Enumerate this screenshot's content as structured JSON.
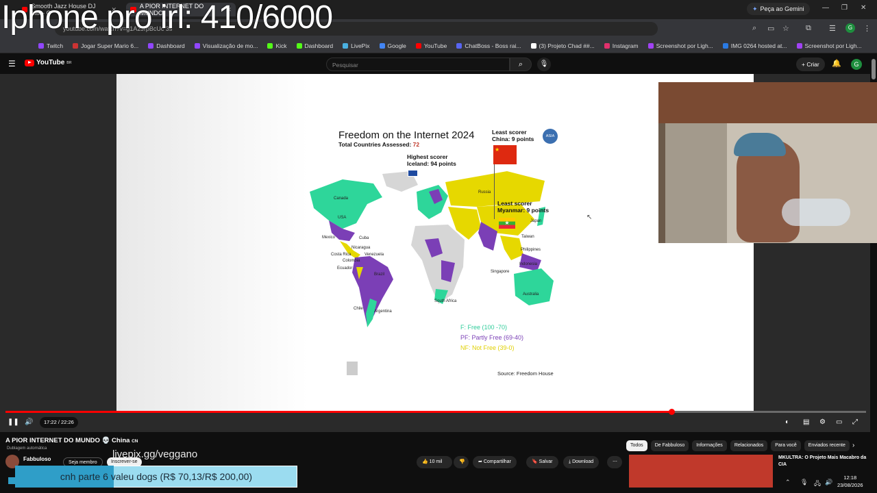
{
  "overlay": {
    "title": "Iphone pro irl: 410/6000"
  },
  "browser": {
    "tabs": [
      {
        "label": "Smooth Jazz House DJ Mix - C",
        "active": false
      },
      {
        "label": "A PIOR INTERNET DO MUNDO",
        "active": true
      }
    ],
    "gemini_label": "Peça ao Gemini",
    "url": "youtube.com/watch?v=g1A2JrpBcUc 3s",
    "bookmarks": [
      {
        "label": "Twitch",
        "color": "#9146ff"
      },
      {
        "label": "Jogar Super Mario 6...",
        "color": "#cc3333"
      },
      {
        "label": "Dashboard",
        "color": "#9146ff"
      },
      {
        "label": "Visualização de mo...",
        "color": "#9146ff"
      },
      {
        "label": "Kick",
        "color": "#53fc18"
      },
      {
        "label": "Dashboard",
        "color": "#53fc18"
      },
      {
        "label": "LivePix",
        "color": "#4ab0e0"
      },
      {
        "label": "Google",
        "color": "#4285f4"
      },
      {
        "label": "YouTube",
        "color": "#ff0000"
      },
      {
        "label": "ChatBoss - Boss rai...",
        "color": "#5865f2"
      },
      {
        "label": "(3) Projeto Chad ##...",
        "color": "#ffffff"
      },
      {
        "label": "Instagram",
        "color": "#e1306c"
      },
      {
        "label": "Screenshot por Ligh...",
        "color": "#a142f4"
      },
      {
        "label": "IMG 0264 hosted at...",
        "color": "#2a7ae2"
      },
      {
        "label": "Screenshot por Ligh...",
        "color": "#a142f4"
      }
    ]
  },
  "youtube": {
    "logo": "YouTube",
    "logo_region": "BR",
    "search_placeholder": "Pesquisar",
    "create_label": "Criar",
    "avatar_letter": "G"
  },
  "map": {
    "title": "Freedom on the Internet 2024",
    "subtitle_prefix": "Total Countries Assessed:",
    "subtitle_count": "72",
    "highest_title": "Highest scorer",
    "highest_value": "Iceland: 94 points",
    "least1_title": "Least scorer",
    "least1_value": "China: 9 points",
    "least2_title": "Least scorer",
    "least2_value": "Myanmar: 9 points",
    "asia_badge": "ASIA",
    "legend_free": "F: Free (100 -70)",
    "legend_partly": "PF: Partly Free (69-40)",
    "legend_not": "NF: Not Free (39-0)",
    "source": "Source: Freedom House",
    "countries": [
      "Canada",
      "USA",
      "Mexico",
      "Cuba",
      "Nicaragua",
      "Costa Rica",
      "Colombia",
      "Venezuela",
      "Ecuador",
      "Brazil",
      "Chile",
      "Argentina",
      "Russia",
      "Japan",
      "Taiwan",
      "Philippines",
      "Indonesia",
      "Singapore",
      "Australia",
      "South Africa"
    ]
  },
  "player": {
    "time": "17:22 / 22:26",
    "progress": 0.774
  },
  "video": {
    "title": "A PIOR INTERNET DO MUNDO 💀 China",
    "title_flag": "CN",
    "dubbing": "Dublagem automática",
    "channel": "Fabbuloso",
    "member_label": "Seja membro",
    "subscribe_label": "Inscrever-se",
    "livepix_overlay": "livepix.gg/veggano",
    "likes": "10 mil",
    "share_label": "Compartilhar",
    "save_label": "Salvar",
    "download_label": "Download"
  },
  "sidebar": {
    "chips": [
      {
        "label": "Todos",
        "active": true
      },
      {
        "label": "De Fabbuloso",
        "active": false
      },
      {
        "label": "Informações",
        "active": false
      },
      {
        "label": "Relacionados",
        "active": false
      },
      {
        "label": "Para você",
        "active": false
      },
      {
        "label": "Enviados recente",
        "active": false
      }
    ],
    "rec_title": "MKULTRA: O Projeto Mais Macabro da CIA"
  },
  "donation": {
    "text": "cnh parte 6 valeu dogs (R$ 70,13/R$ 200,00)",
    "progress": 0.35
  },
  "taskbar": {
    "time": "12:18",
    "date": "23/08/2026"
  }
}
